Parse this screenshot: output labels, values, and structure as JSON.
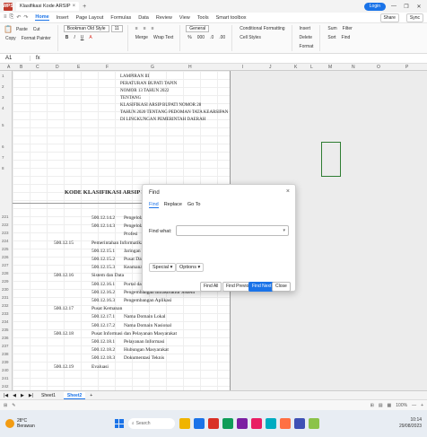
{
  "titlebar": {
    "app_name": "WPS",
    "tab_label": "Klasifikasi Kode ARSIP",
    "login_label": "Login",
    "controls": [
      "—",
      "❐",
      "✕"
    ]
  },
  "menubar": {
    "quick_access": [
      "≡",
      "⎘",
      "↶",
      "↷"
    ],
    "items": [
      "Home",
      "Insert",
      "Page Layout",
      "Formulas",
      "Data",
      "Review",
      "View",
      "Tools",
      "Smart toolbox"
    ],
    "active": "Home",
    "right_buttons": [
      "Share",
      "Sync"
    ]
  },
  "ribbon": {
    "clipboard": [
      "Paste",
      "Cut",
      "Copy",
      "Format Painter"
    ],
    "font_name": "Bookman Old Style",
    "font_size": "11",
    "font_buttons": [
      "B",
      "I",
      "U",
      "A"
    ],
    "align_buttons": [
      "≡",
      "≡",
      "≡",
      "Merge"
    ],
    "wrap": "Wrap Text",
    "number_format": "General",
    "number_buttons": [
      "%",
      "000",
      ".0",
      ".00"
    ],
    "styles": [
      "Conditional Formatting",
      "Cell Styles"
    ],
    "cells": [
      "Insert",
      "Delete",
      "Format"
    ],
    "editing": [
      "Sum",
      "Filter",
      "Sort",
      "Find"
    ]
  },
  "formula": {
    "namebox": "A1",
    "fx": "fx"
  },
  "columns": [
    "A",
    "B",
    "C",
    "D",
    "E",
    "F",
    "G",
    "H",
    "I",
    "J",
    "K",
    "L",
    "M",
    "N",
    "O",
    "P"
  ],
  "rows": [
    "1",
    "2",
    "3",
    "4",
    "5",
    "6",
    "7",
    "8",
    "221",
    "222",
    "223",
    "224",
    "225",
    "226",
    "227",
    "228",
    "229",
    "230",
    "231",
    "232",
    "233",
    "234",
    "235",
    "236",
    "237",
    "238",
    "239",
    "240",
    "241",
    "242"
  ],
  "document": {
    "header_lines": [
      "LAMPIRAN III",
      "PERATURAN BUPATI TAPIN",
      "NOMOR 13 TAHUN 2022",
      "TENTANG",
      "KLASIFIKASI ARSIP BUPATI NOMOR 28",
      "TAHUN 2020 TENTANG PEDOMAN TATA KEARSIPAN",
      "DI LINGKUNGAN PEMERINTAH DAERAH"
    ],
    "kode_title": "KODE KLASIFIKASI ARSIP PEMERINTAH",
    "table_rows": [
      {
        "code": "",
        "sub": "500.12.14.2",
        "desc": "Pengelolaan"
      },
      {
        "code": "",
        "sub": "500.12.14.3",
        "desc": "Pengelolaan"
      },
      {
        "code": "",
        "sub": "",
        "desc": "Profesi"
      },
      {
        "code": "500.12.15",
        "sub": "",
        "desc": "Pemerintahan Informatika"
      },
      {
        "code": "",
        "sub": "500.12.15.1",
        "desc": "Jaringan"
      },
      {
        "code": "",
        "sub": "500.12.15.2",
        "desc": "Pusat Data"
      },
      {
        "code": "",
        "sub": "500.12.15.3",
        "desc": "Keamanan"
      },
      {
        "code": "500.12.16",
        "sub": "",
        "desc": "Sistem dan Data"
      },
      {
        "code": "",
        "sub": "500.12.16.1",
        "desc": "Portal dan Website"
      },
      {
        "code": "",
        "sub": "500.12.16.2",
        "desc": "Pengembangan Infrastruktur Sistem"
      },
      {
        "code": "",
        "sub": "500.12.16.3",
        "desc": "Pengembangan Aplikasi"
      },
      {
        "code": "500.12.17",
        "sub": "",
        "desc": "Pusat Kemanan"
      },
      {
        "code": "",
        "sub": "500.12.17.1",
        "desc": "Nama Domain Lokal"
      },
      {
        "code": "",
        "sub": "500.12.17.2",
        "desc": "Nama Domain Nasional"
      },
      {
        "code": "500.12.18",
        "sub": "",
        "desc": "Pusat Informasi dan Pelayanan Masyarakat"
      },
      {
        "code": "",
        "sub": "500.12.18.1",
        "desc": "Pelayanan Informasi"
      },
      {
        "code": "",
        "sub": "500.12.18.2",
        "desc": "Hubungan Masyarakat"
      },
      {
        "code": "",
        "sub": "500.12.18.3",
        "desc": "Dokumentasi Teknis"
      },
      {
        "code": "500.12.19",
        "sub": "",
        "desc": "Evaluasi"
      }
    ]
  },
  "sheets": {
    "nav": [
      "|◀",
      "◀",
      "▶",
      "▶|"
    ],
    "tabs": [
      "Sheet1",
      "Sheet2"
    ],
    "active": "Sheet2",
    "add": "+"
  },
  "status": {
    "left": [
      "⊞",
      "✎"
    ],
    "right": [
      "⊞",
      "▤",
      "▦",
      "100%",
      "—",
      "+"
    ]
  },
  "taskbar": {
    "weather_temp": "28°C",
    "weather_desc": "Berawan",
    "search_label": "Search",
    "time": "10:14",
    "date": "29/08/2023",
    "app_colors": [
      "#f0b400",
      "#1a73e8",
      "#d93025",
      "#0f9d58",
      "#7b1fa2",
      "#e91e63",
      "#00acc1",
      "#ff7043",
      "#3f51b5",
      "#8bc34a"
    ]
  },
  "find_dialog": {
    "title": "Find",
    "close": "×",
    "tabs": [
      "Find",
      "Replace",
      "Go To"
    ],
    "active_tab": "Find",
    "find_label": "Find what:",
    "find_value": "",
    "dropdown": "▾",
    "special_label": "Special ▾",
    "options_label": "Options ▾",
    "buttons": [
      "Find All",
      "Find Previous",
      "Find Next",
      "Close"
    ],
    "primary_button": "Find Next"
  },
  "colors": {
    "accent": "#1a73e8",
    "selection": "#2e7d32",
    "app_icon": "#c0392b"
  }
}
